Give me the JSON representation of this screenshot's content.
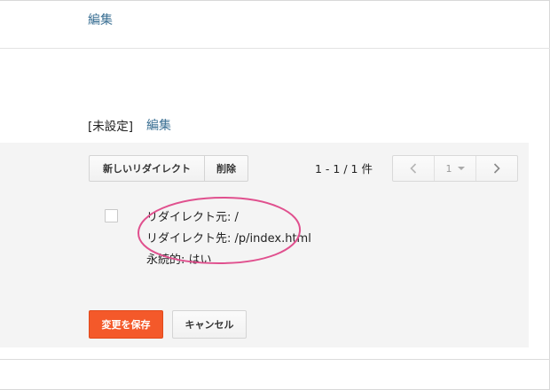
{
  "header": {
    "edit_label": "編集"
  },
  "setting": {
    "status": "[未設定]",
    "edit_label": "編集"
  },
  "toolbar": {
    "new_redirect_label": "新しいリダイレクト",
    "delete_label": "削除",
    "page_count": "1 - 1 / 1 件"
  },
  "pager": {
    "current_page": "1"
  },
  "redirect": {
    "from": "リダイレクト元: /",
    "to": "リダイレクト先: /p/index.html",
    "permanent": "永続的: はい"
  },
  "actions": {
    "save_label": "変更を保存",
    "cancel_label": "キャンセル"
  },
  "colors": {
    "link": "#3a6f93",
    "save_button": "#f4592a",
    "annotation": "#e0508e",
    "panel_bg": "#f4f4f4"
  },
  "icons": {
    "prev": "chevron-left-icon",
    "next": "chevron-right-icon",
    "dropdown": "caret-down-icon"
  }
}
